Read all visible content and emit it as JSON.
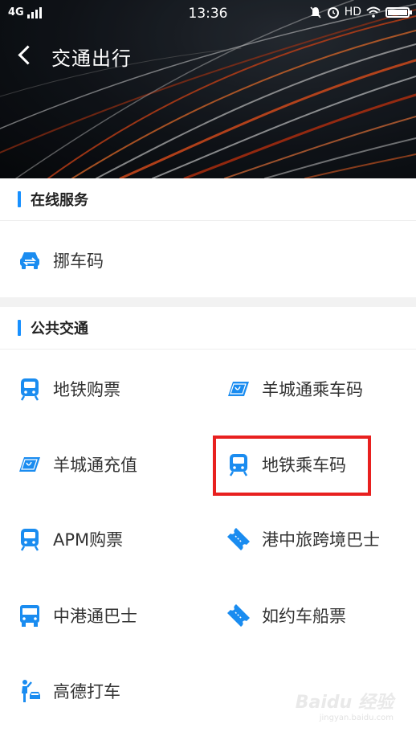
{
  "status_bar": {
    "network": "4G",
    "time": "13:36",
    "hd": "HD",
    "battery_level": 1.0
  },
  "header": {
    "title": "交通出行"
  },
  "sections": [
    {
      "title": "在线服务",
      "items": [
        {
          "label": "挪车码",
          "icon": "car-front-icon"
        }
      ]
    },
    {
      "title": "公共交通",
      "items": [
        {
          "label": "地铁购票",
          "icon": "metro-icon"
        },
        {
          "label": "羊城通乘车码",
          "icon": "card-icon"
        },
        {
          "label": "羊城通充值",
          "icon": "card-icon"
        },
        {
          "label": "地铁乘车码",
          "icon": "metro-icon"
        },
        {
          "label": "APM购票",
          "icon": "metro-icon"
        },
        {
          "label": "港中旅跨境巴士",
          "icon": "ticket-icon"
        },
        {
          "label": "中港通巴士",
          "icon": "bus-icon"
        },
        {
          "label": "如约车船票",
          "icon": "ticket-icon"
        },
        {
          "label": "高德打车",
          "icon": "taxi-hail-icon"
        }
      ]
    }
  ],
  "annotation": {
    "highlighted_item": "地铁乘车码",
    "color": "#e8201f"
  },
  "watermark": {
    "logo": "Baidu 经验",
    "url": "jingyan.baidu.com"
  },
  "colors": {
    "accent": "#1890ff",
    "icon": "#1a8cf0"
  }
}
